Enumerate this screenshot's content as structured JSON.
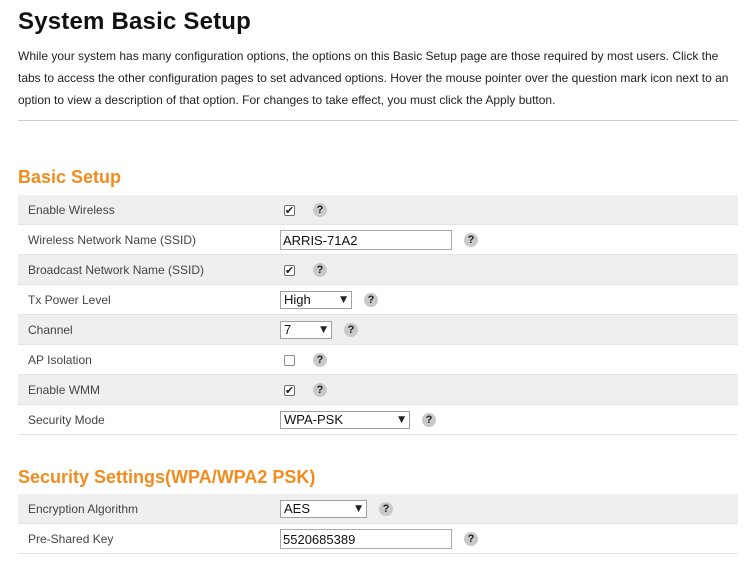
{
  "page": {
    "title": "System Basic Setup",
    "intro_lines": [
      "While your system has many configuration options, the options on this Basic Setup page are those required by most users. Click the",
      "tabs to access the other configuration pages to set advanced options. Hover the mouse pointer over the question mark icon next to an",
      "option to view a description of that option. For changes to take effect, you must click the Apply button."
    ]
  },
  "basic_setup": {
    "title": "Basic Setup",
    "enable_wireless": {
      "label": "Enable Wireless",
      "checked": true
    },
    "ssid": {
      "label": "Wireless Network Name (SSID)",
      "value": "ARRIS-71A2"
    },
    "broadcast_ssid": {
      "label": "Broadcast Network Name (SSID)",
      "checked": true
    },
    "tx_power": {
      "label": "Tx Power Level",
      "value": "High"
    },
    "channel": {
      "label": "Channel",
      "value": "7"
    },
    "ap_isolation": {
      "label": "AP Isolation",
      "checked": false
    },
    "enable_wmm": {
      "label": "Enable WMM",
      "checked": true
    },
    "security_mode": {
      "label": "Security Mode",
      "value": "WPA-PSK"
    }
  },
  "security_settings": {
    "title": "Security Settings(WPA/WPA2 PSK)",
    "encryption": {
      "label": "Encryption Algorithm",
      "value": "AES"
    },
    "psk": {
      "label": "Pre-Shared Key",
      "value": "5520685389"
    }
  },
  "icons": {
    "help": "?",
    "check": "✔",
    "dropdown": "▼"
  },
  "colors": {
    "section_title": "#f28c1e",
    "row_alt_bg": "#efefef",
    "help_icon_bg": "#c9c9c9"
  }
}
